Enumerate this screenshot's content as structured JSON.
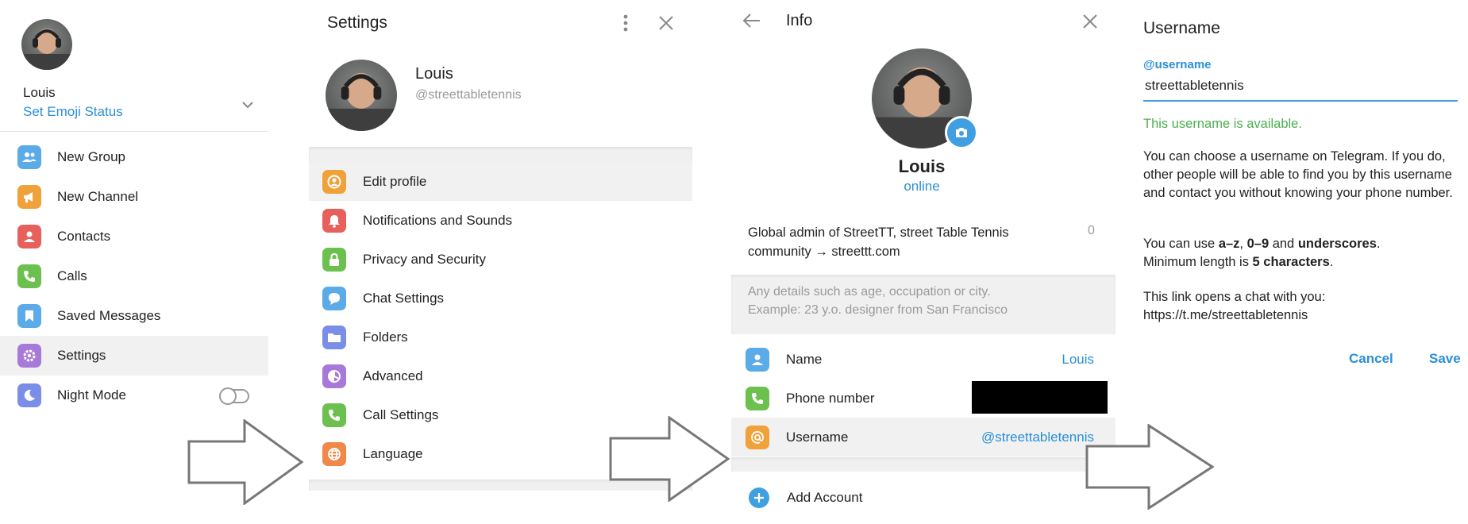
{
  "colors": {
    "accent": "#2a8fd6",
    "success": "#4caf50",
    "blue": "#5aabe8",
    "orange": "#f0a13a",
    "red": "#e8605c",
    "green": "#6cc14e",
    "purple": "#a77ad9",
    "periwinkle": "#7a8ee8"
  },
  "panel1": {
    "user_name": "Louis",
    "set_emoji_status": "Set Emoji Status",
    "menu": [
      {
        "label": "New Group",
        "icon": "group-icon"
      },
      {
        "label": "New Channel",
        "icon": "megaphone-icon"
      },
      {
        "label": "Contacts",
        "icon": "person-icon"
      },
      {
        "label": "Calls",
        "icon": "phone-icon"
      },
      {
        "label": "Saved Messages",
        "icon": "bookmark-icon"
      },
      {
        "label": "Settings",
        "icon": "gear-icon",
        "active": true
      },
      {
        "label": "Night Mode",
        "icon": "moon-icon",
        "toggle": false
      }
    ]
  },
  "panel2": {
    "title": "Settings",
    "user_name": "Louis",
    "username": "@streettabletennis",
    "menu": [
      {
        "label": "Edit profile",
        "icon": "user-circle-icon",
        "active": true
      },
      {
        "label": "Notifications and Sounds",
        "icon": "bell-icon"
      },
      {
        "label": "Privacy and Security",
        "icon": "lock-icon"
      },
      {
        "label": "Chat Settings",
        "icon": "chat-bubble-icon"
      },
      {
        "label": "Folders",
        "icon": "folder-icon"
      },
      {
        "label": "Advanced",
        "icon": "pie-chart-icon"
      },
      {
        "label": "Call Settings",
        "icon": "phone-icon"
      },
      {
        "label": "Language",
        "icon": "globe-icon"
      }
    ]
  },
  "panel3": {
    "title": "Info",
    "name": "Louis",
    "status": "online",
    "bio_line1": "Global admin of StreetTT, street Table Tennis",
    "bio_line2": "community → streettt.com",
    "bio_count": "0",
    "bio_hint_line1": "Any details such as age, occupation or city.",
    "bio_hint_line2": "Example: 23 y.o. designer from San Francisco",
    "fields": [
      {
        "label": "Name",
        "value": "Louis",
        "icon": "person-icon"
      },
      {
        "label": "Phone number",
        "value": "",
        "icon": "phone-icon",
        "redacted": true
      },
      {
        "label": "Username",
        "value": "@streettabletennis",
        "icon": "at-icon"
      }
    ],
    "add_account": "Add Account"
  },
  "panel4": {
    "title": "Username",
    "field_label": "@username",
    "field_value": "streettabletennis",
    "availability": "This username is available.",
    "desc_1": "You can choose a username on Telegram. If you do, other people will be able to find you by this username and contact you without knowing your phone number.",
    "rules_prefix": "You can use ",
    "rules_az": "a–z",
    "rules_comma": ", ",
    "rules_09": "0–9",
    "rules_and": " and ",
    "rules_underscores": "underscores",
    "rules_end": ".",
    "min_prefix": "Minimum length is ",
    "min_value": "5 characters",
    "min_end": ".",
    "link_intro": "This link opens a chat with you:",
    "link": "https://t.me/streettabletennis",
    "cancel": "Cancel",
    "save": "Save"
  }
}
